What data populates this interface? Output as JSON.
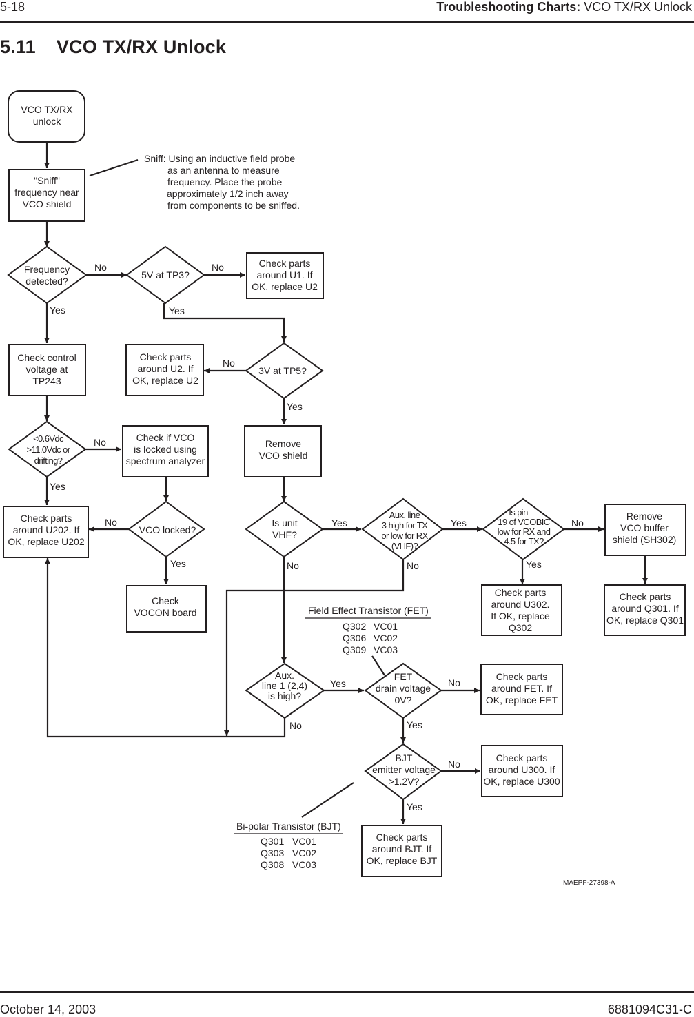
{
  "header": {
    "page_number": "5-18",
    "section_bold": "Troubleshooting Charts:",
    "section_rest": " VCO TX/RX Unlock"
  },
  "title": {
    "number": "5.11",
    "text": "VCO TX/RX Unlock"
  },
  "footer": {
    "date": "October 14, 2003",
    "doc_number": "6881094C31-C"
  },
  "flowchart": {
    "nodes": {
      "start": {
        "lines": [
          "VCO TX/RX",
          "unlock"
        ]
      },
      "sniff": {
        "lines": [
          "\"Sniff\"",
          "frequency near",
          "VCO shield"
        ]
      },
      "freq_detected": {
        "lines": [
          "Frequency",
          "detected?"
        ]
      },
      "tp3": {
        "lines": [
          "5V at TP3?"
        ]
      },
      "u1": {
        "lines": [
          "Check parts",
          "around U1. If",
          "OK, replace U2"
        ]
      },
      "ctrl_voltage": {
        "lines": [
          "Check control",
          "voltage at",
          "TP243"
        ]
      },
      "u2": {
        "lines": [
          "Check parts",
          "around U2. If",
          "OK, replace U2"
        ]
      },
      "tp5": {
        "lines": [
          "3V at TP5?"
        ]
      },
      "drifting": {
        "lines": [
          "<0.6Vdc",
          ">11.0Vdc or",
          "drifting?"
        ]
      },
      "spectrum": {
        "lines": [
          "Check if VCO",
          "is locked using",
          "spectrum analyzer"
        ]
      },
      "remove_shield": {
        "lines": [
          "Remove",
          "VCO shield"
        ]
      },
      "u202": {
        "lines": [
          "Check parts",
          "around U202. If",
          "OK, replace U202"
        ]
      },
      "vco_locked": {
        "lines": [
          "VCO locked?"
        ]
      },
      "is_vhf": {
        "lines": [
          "Is  unit",
          "VHF?"
        ]
      },
      "aux3": {
        "lines": [
          "Aux. line",
          "3 high for TX",
          "or low for RX",
          "(VHF)?"
        ]
      },
      "pin19": {
        "lines": [
          "Is pin",
          "19 of VCOBIC",
          "low for RX and",
          "4.5 for TX?"
        ]
      },
      "buffer_shield": {
        "lines": [
          "Remove",
          "VCO buffer",
          "shield (SH302)"
        ]
      },
      "vocon": {
        "lines": [
          "Check",
          "VOCON board"
        ]
      },
      "u302": {
        "lines": [
          "Check parts",
          "around U302.",
          "If OK, replace",
          "Q302"
        ]
      },
      "q301": {
        "lines": [
          "Check parts",
          "around Q301. If",
          "OK, replace Q301"
        ]
      },
      "aux1": {
        "lines": [
          "Aux.",
          "line 1 (2,4)",
          "is high?"
        ]
      },
      "fet_drain": {
        "lines": [
          "FET",
          "drain voltage",
          "0V?"
        ]
      },
      "fet_parts": {
        "lines": [
          "Check parts",
          "around FET. If",
          "OK, replace FET"
        ]
      },
      "bjt_emitter": {
        "lines": [
          "BJT",
          "emitter voltage",
          ">1.2V?"
        ]
      },
      "u300": {
        "lines": [
          "Check parts",
          "around U300. If",
          "OK, replace U300"
        ]
      },
      "bjt_parts": {
        "lines": [
          "Check parts",
          "around BJT. If",
          "OK, replace BJT"
        ]
      }
    },
    "edge_labels": {
      "yes": "Yes",
      "no": "No"
    },
    "sniff_note": {
      "lines": [
        "Sniff: Using an inductive field probe",
        "as an antenna to measure",
        "frequency. Place the probe",
        "approximately 1/2 inch away",
        "from components to be sniffed."
      ]
    },
    "fet_table": {
      "title": "Field Effect Transistor (FET)",
      "rows": [
        [
          "Q302",
          "VC01"
        ],
        [
          "Q306",
          "VC02"
        ],
        [
          "Q309",
          "VC03"
        ]
      ]
    },
    "bjt_table": {
      "title": "Bi-polar Transistor (BJT)",
      "rows": [
        [
          "Q301",
          "VC01"
        ],
        [
          "Q303",
          "VC02"
        ],
        [
          "Q308",
          "VC03"
        ]
      ]
    },
    "figure_code": "MAEPF-27398-A"
  }
}
